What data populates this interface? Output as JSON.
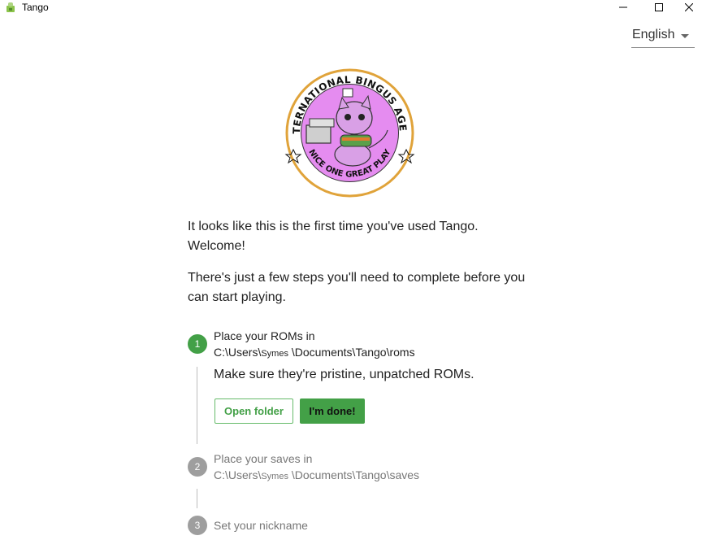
{
  "window": {
    "title": "Tango"
  },
  "language": {
    "selected": "English"
  },
  "logo": {
    "ring_text_top": "NINTERNATIONAL BINGUS AGENCY",
    "ring_text_bottom": "NICE ONE GREAT PLAY"
  },
  "intro": {
    "line1": "It looks like this is the first time you've used Tango. Welcome!",
    "line2": "There's just a few steps you'll need to complete before you can start playing."
  },
  "steps": [
    {
      "number": "1",
      "title": "Place your ROMs in",
      "path_prefix": "C:\\Users\\",
      "path_user": "Symes",
      "path_suffix": " \\Documents\\Tango\\roms",
      "description": "Make sure they're pristine, unpatched ROMs.",
      "open_folder_label": "Open folder",
      "done_label": "I'm done!"
    },
    {
      "number": "2",
      "title": "Place your saves in",
      "path_prefix": "C:\\Users\\",
      "path_user": "Symes",
      "path_suffix": " \\Documents\\Tango\\saves"
    },
    {
      "number": "3",
      "title": "Set your nickname"
    }
  ],
  "colors": {
    "accent": "#43a047",
    "inactive_step": "#9e9e9e",
    "logo_ring": "#e0a33a",
    "logo_center": "#e58cf0"
  }
}
